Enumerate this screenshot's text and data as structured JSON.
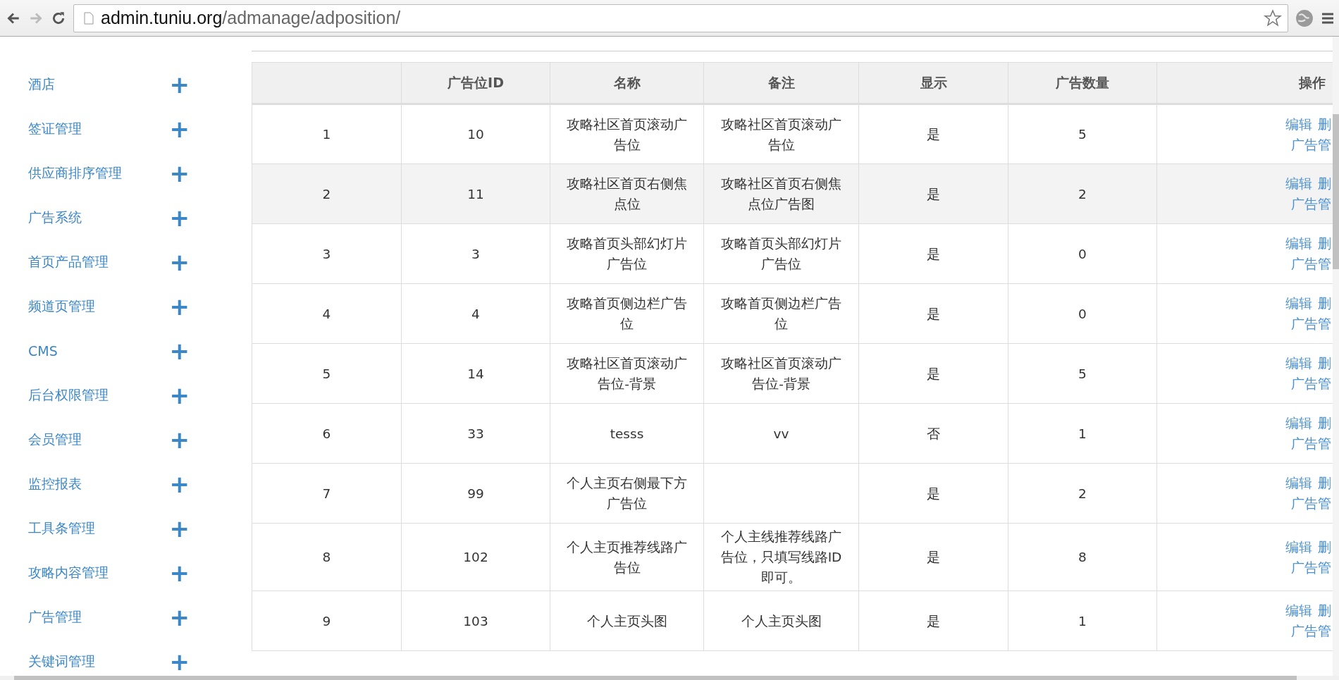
{
  "browser": {
    "address": {
      "host": "admin.tuniu.org",
      "path": "/admanage/adposition/"
    }
  },
  "sidebar": {
    "items": [
      {
        "label": "酒店",
        "expand": "+"
      },
      {
        "label": "签证管理",
        "expand": "+"
      },
      {
        "label": "供应商排序管理",
        "expand": "+"
      },
      {
        "label": "广告系统",
        "expand": "+"
      },
      {
        "label": "首页产品管理",
        "expand": "+"
      },
      {
        "label": "频道页管理",
        "expand": "+"
      },
      {
        "label": "CMS",
        "expand": "+"
      },
      {
        "label": "后台权限管理",
        "expand": "+"
      },
      {
        "label": "会员管理",
        "expand": "+"
      },
      {
        "label": "监控报表",
        "expand": "+"
      },
      {
        "label": "工具条管理",
        "expand": "+"
      },
      {
        "label": "攻略内容管理",
        "expand": "+"
      },
      {
        "label": "广告管理",
        "expand": "+"
      },
      {
        "label": "关键词管理",
        "expand": "+"
      }
    ]
  },
  "table": {
    "columns": [
      "",
      "广告位ID",
      "名称",
      "备注",
      "显示",
      "广告数量",
      "操作"
    ],
    "rows": [
      {
        "cells": [
          "1",
          "10",
          "攻略社区首页滚动广告位",
          "攻略社区首页滚动广告位",
          "是",
          "5"
        ],
        "actions": [
          "编辑",
          "删",
          "广告管"
        ],
        "highlighted": false
      },
      {
        "cells": [
          "2",
          "11",
          "攻略社区首页右侧焦点位",
          "攻略社区首页右侧焦点位广告图",
          "是",
          "2"
        ],
        "actions": [
          "编辑",
          "删",
          "广告管"
        ],
        "highlighted": true
      },
      {
        "cells": [
          "3",
          "3",
          "攻略首页头部幻灯片广告位",
          "攻略首页头部幻灯片广告位",
          "是",
          "0"
        ],
        "actions": [
          "编辑",
          "删",
          "广告管"
        ],
        "highlighted": false
      },
      {
        "cells": [
          "4",
          "4",
          "攻略首页侧边栏广告位",
          "攻略首页侧边栏广告位",
          "是",
          "0"
        ],
        "actions": [
          "编辑",
          "删",
          "广告管"
        ],
        "highlighted": false
      },
      {
        "cells": [
          "5",
          "14",
          "攻略社区首页滚动广告位-背景",
          "攻略社区首页滚动广告位-背景",
          "是",
          "5"
        ],
        "actions": [
          "编辑",
          "删",
          "广告管"
        ],
        "highlighted": false
      },
      {
        "cells": [
          "6",
          "33",
          "tesss",
          "vv",
          "否",
          "1"
        ],
        "actions": [
          "编辑",
          "删",
          "广告管"
        ],
        "highlighted": false
      },
      {
        "cells": [
          "7",
          "99",
          "个人主页右侧最下方广告位",
          "",
          "是",
          "2"
        ],
        "actions": [
          "编辑",
          "删",
          "广告管"
        ],
        "highlighted": false
      },
      {
        "cells": [
          "8",
          "102",
          "个人主页推荐线路广告位",
          "个人主线推荐线路广告位，只填写线路ID即可。",
          "是",
          "8"
        ],
        "actions": [
          "编辑",
          "删",
          "广告管"
        ],
        "highlighted": false
      },
      {
        "cells": [
          "9",
          "103",
          "个人主页头图",
          "个人主页头图",
          "是",
          "1"
        ],
        "actions": [
          "编辑",
          "删",
          "广告管"
        ],
        "highlighted": false
      }
    ]
  }
}
